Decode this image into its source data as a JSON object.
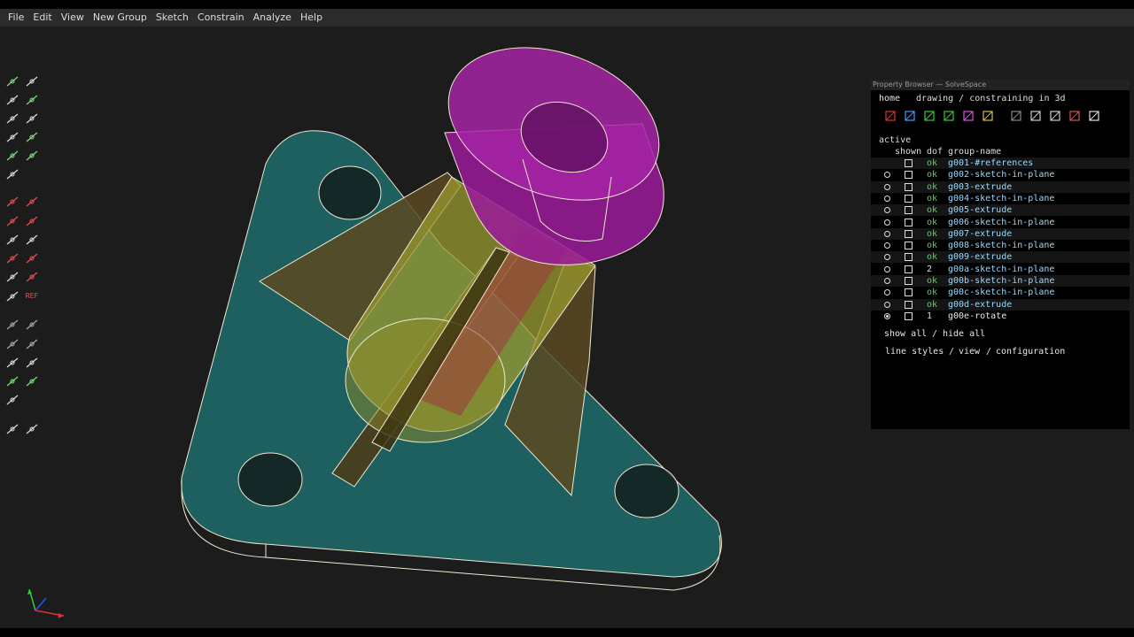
{
  "menu": [
    "File",
    "Edit",
    "View",
    "New Group",
    "Sketch",
    "Constrain",
    "Analyze",
    "Help"
  ],
  "toolbar_icons": [
    {
      "name": "line-icon",
      "label": ""
    },
    {
      "name": "rectangle-icon",
      "label": ""
    },
    {
      "name": "circle-icon",
      "label": ""
    },
    {
      "name": "arc-icon",
      "label": ""
    },
    {
      "name": "text-icon",
      "label": ""
    },
    {
      "name": "image-icon",
      "label": ""
    },
    {
      "name": "tangent-arc-icon",
      "label": ""
    },
    {
      "name": "bezier-icon",
      "label": ""
    },
    {
      "name": "point-icon",
      "label": ""
    },
    {
      "name": "workplane-point-icon",
      "label": ""
    },
    {
      "name": "split-curves-icon",
      "label": ""
    },
    {
      "name": "distance-constraint-icon",
      "label": ""
    },
    {
      "name": "angle-constraint-icon",
      "label": ""
    },
    {
      "name": "horizontal-constraint-icon",
      "label": ""
    },
    {
      "name": "vertical-constraint-icon",
      "label": ""
    },
    {
      "name": "parallel-constraint-icon",
      "label": ""
    },
    {
      "name": "perpendicular-constraint-icon",
      "label": ""
    },
    {
      "name": "point-on-line-icon",
      "label": ""
    },
    {
      "name": "symmetric-icon",
      "label": ""
    },
    {
      "name": "equal-icon",
      "label": ""
    },
    {
      "name": "same-orientation-icon",
      "label": ""
    },
    {
      "name": "construction-icon",
      "label": ""
    },
    {
      "name": "reference-icon",
      "label": "REF"
    },
    {
      "name": "step-translate-icon",
      "label": ""
    },
    {
      "name": "step-rotate-icon",
      "label": ""
    },
    {
      "name": "extrude-icon",
      "label": ""
    },
    {
      "name": "lathe-icon",
      "label": ""
    },
    {
      "name": "helix-icon",
      "label": ""
    },
    {
      "name": "revolve-icon",
      "label": ""
    },
    {
      "name": "sketch-in-3d-icon",
      "label": ""
    },
    {
      "name": "sketch-in-workplane-icon",
      "label": ""
    },
    {
      "name": "link-file-icon",
      "label": ""
    },
    {
      "name": "assemble-icon",
      "label": ""
    },
    {
      "name": "section-icon",
      "label": ""
    }
  ],
  "property_browser": {
    "window_title": "Property Browser — SolveSpace",
    "home": "home",
    "breadcrumb": "drawing / constraining in 3d",
    "icons": [
      "show-workplanes-icon",
      "show-normals-icon",
      "show-points-icon",
      "show-construction-icon",
      "show-constraints-icon",
      "show-faces-icon",
      "show-shaded-icon",
      "show-edges-icon",
      "show-outlines-icon",
      "show-mesh-icon",
      "show-hidden-lines-icon"
    ],
    "active_label": "active",
    "columns": {
      "shown": "shown",
      "dof": "dof",
      "name": "group-name"
    },
    "groups": [
      {
        "dof": "ok",
        "name": "g001-#references",
        "radio": false,
        "active": false
      },
      {
        "dof": "ok",
        "name": "g002-sketch-in-plane",
        "radio": true,
        "active": false
      },
      {
        "dof": "ok",
        "name": "g003-extrude",
        "radio": true,
        "active": false
      },
      {
        "dof": "ok",
        "name": "g004-sketch-in-plane",
        "radio": true,
        "active": false
      },
      {
        "dof": "ok",
        "name": "g005-extrude",
        "radio": true,
        "active": false
      },
      {
        "dof": "ok",
        "name": "g006-sketch-in-plane",
        "radio": true,
        "active": false
      },
      {
        "dof": "ok",
        "name": "g007-extrude",
        "radio": true,
        "active": false
      },
      {
        "dof": "ok",
        "name": "g008-sketch-in-plane",
        "radio": true,
        "active": false
      },
      {
        "dof": "ok",
        "name": "g009-extrude",
        "radio": true,
        "active": false
      },
      {
        "dof": "2",
        "name": "g00a-sketch-in-plane",
        "radio": true,
        "active": false
      },
      {
        "dof": "ok",
        "name": "g00b-sketch-in-plane",
        "radio": true,
        "active": false
      },
      {
        "dof": "ok",
        "name": "g00c-sketch-in-plane",
        "radio": true,
        "active": false
      },
      {
        "dof": "ok",
        "name": "g00d-extrude",
        "radio": true,
        "active": false
      },
      {
        "dof": "1",
        "name": "g00e-rotate",
        "radio": true,
        "active": true
      }
    ],
    "show_all": "show all",
    "hide_all": "hide all",
    "line_styles": "line styles",
    "view": "view",
    "configuration": "configuration"
  },
  "colors": {
    "base_plate": "#1f6b6b",
    "ribs": "#6b5a2a",
    "tube": "#b8b838",
    "cap": "#a020a0",
    "edges": "#f0e8d0"
  }
}
